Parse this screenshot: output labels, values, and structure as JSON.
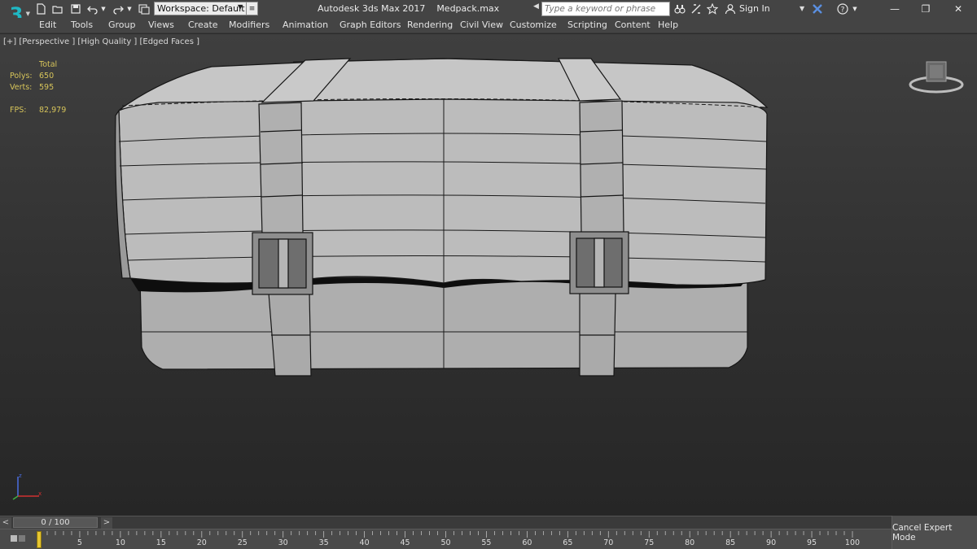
{
  "window": {
    "title": "Autodesk 3ds Max 2017    Medpack.max",
    "workspace_label": "Workspace: Default",
    "search_placeholder": "Type a keyword or phrase",
    "sign_in": "Sign In"
  },
  "menu": [
    "Edit",
    "Tools",
    "Group",
    "Views",
    "Create",
    "Modifiers",
    "Animation",
    "Graph Editors",
    "Rendering",
    "Civil View",
    "Customize",
    "Scripting",
    "Content",
    "Help"
  ],
  "viewport": {
    "label": "[+] [Perspective ] [High Quality ] [Edged Faces ]",
    "stats": {
      "header": "Total",
      "polys_label": "Polys:",
      "polys_value": "650",
      "verts_label": "Verts:",
      "verts_value": "595",
      "fps_label": "FPS:",
      "fps_value": "82,979"
    }
  },
  "timeline": {
    "slider_value": "0 / 100",
    "ticks": [
      "5",
      "10",
      "15",
      "20",
      "25",
      "30",
      "35",
      "40",
      "45",
      "50",
      "55",
      "60",
      "65",
      "70",
      "75",
      "80",
      "85",
      "90",
      "95",
      "100"
    ],
    "current_frame": 0,
    "total_frames": 100
  },
  "buttons": {
    "cancel_expert": "Cancel Expert Mode"
  },
  "colors": {
    "chrome": "#444444",
    "viewport_top": "#3f3f3f",
    "stats_text": "#d6c45a",
    "model": "#b4b4b4",
    "time_marker": "#e5c530",
    "logo": "#1fb8c4"
  }
}
